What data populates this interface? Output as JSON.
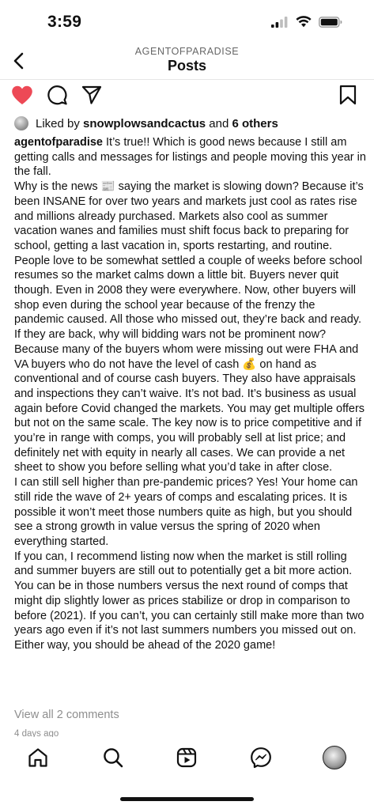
{
  "status": {
    "time": "3:59"
  },
  "header": {
    "account": "AGENTOFPARADISE",
    "title": "Posts"
  },
  "actions": {
    "liked": true,
    "like_color": "#ED4956"
  },
  "likes": {
    "prefix": "Liked by",
    "user": "snowplowsandcactus",
    "connector": "and",
    "others": "6 others"
  },
  "caption": {
    "username": "agentofparadise",
    "paragraphs": [
      "It’s true!! Which is good news because I still am getting calls and messages for listings and people moving this year in the fall.",
      "Why is the news 📰 saying the market is slowing down? Because it’s been INSANE for over two years and markets just cool as rates rise and millions already purchased. Markets also cool as summer vacation wanes and families must shift focus back to preparing for school, getting a last vacation in, sports restarting, and routine. People love to be somewhat settled a couple of weeks before school resumes so the market calms down a little bit. Buyers never quit though. Even in 2008 they were everywhere. Now, other buyers will shop even during the school year because of the frenzy the pandemic caused. All those who missed out, they’re back and ready.",
      "If they are back, why will bidding wars not be prominent now? Because many of the buyers whom were missing out were FHA and VA buyers who do not have the level of cash 💰 on hand as conventional and of course cash buyers. They also have appraisals and inspections they can’t waive. It’s not bad. It’s business as usual again before Covid changed the markets. You may get multiple offers but not on the same scale. The key now is to price competitive and if you’re in range with comps, you will probably sell at list price; and definitely net with equity in nearly all cases. We can provide a net sheet to show you before selling what you’d take in after close.",
      "I can still sell higher than pre-pandemic prices? Yes! Your home can still ride the wave of 2+ years of comps and escalating prices. It is possible it won’t meet those numbers quite as high, but you should see a strong growth in value versus the spring of 2020 when everything started.",
      "If you can, I recommend listing now when the market is still rolling and summer buyers are still out to potentially get a bit more action. You can be in those numbers versus the next round of comps that might dip slightly lower as prices stabilize or drop in comparison to before (2021). If you can’t, you can certainly still make more than two years ago even if it’s not last summers numbers you missed out on. Either way, you should be ahead of the 2020 game!"
    ]
  },
  "comments": {
    "view_all": "View all 2 comments"
  },
  "timestamp": "4 days ago",
  "tabbar": {
    "items": [
      "home-icon",
      "search-icon",
      "reels-icon",
      "messenger-icon",
      "profile-avatar"
    ]
  }
}
